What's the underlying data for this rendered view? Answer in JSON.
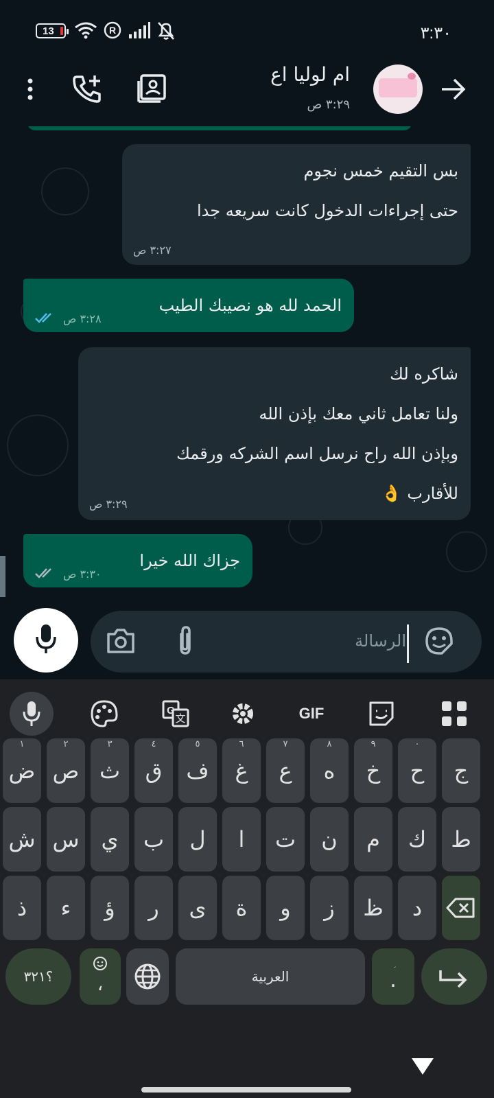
{
  "status_bar": {
    "battery_level": "13",
    "time": "٣:٣٠",
    "icons": [
      "battery-icon",
      "wifi-icon",
      "registered-icon",
      "signal-icon",
      "mute-icon"
    ],
    "colors": {
      "battery_low": "#e53935"
    }
  },
  "header": {
    "contact_name": "ام لوليا اع",
    "last_seen": "٣:٢٩ ص",
    "icons": [
      "back-arrow-icon",
      "avatar",
      "contact-card-icon",
      "add-call-icon",
      "more-options-icon"
    ]
  },
  "messages": [
    {
      "direction": "incoming",
      "lines": [
        "بس التقيم خمس نجوم",
        "حتى إجراءات الدخول كانت سريعه جدا"
      ],
      "time": "٣:٢٧ ص"
    },
    {
      "direction": "outgoing",
      "lines": [
        "الحمد لله هو نصيبك الطيب"
      ],
      "time": "٣:٢٨ ص",
      "status": "read"
    },
    {
      "direction": "incoming",
      "lines": [
        "شاكره لك",
        "ولنا تعامل ثاني معك بإذن الله",
        "وبإذن الله راح نرسل اسم الشركه ورقمك",
        "للأقارب 👌"
      ],
      "time": "٣:٢٩ ص"
    },
    {
      "direction": "outgoing",
      "lines": [
        "جزاك الله خيرا"
      ],
      "time": "٣:٣٠ ص",
      "status": "delivered"
    }
  ],
  "input": {
    "placeholder": "الرسالة",
    "value": "",
    "icons": [
      "sticker-icon",
      "attach-icon",
      "camera-icon",
      "mic-icon"
    ]
  },
  "keyboard": {
    "toolbar": [
      "mic-icon",
      "palette-icon",
      "translate-icon",
      "settings-icon",
      "gif-icon",
      "clipboard-icon",
      "apps-grid-icon"
    ],
    "gif_label": "GIF",
    "row1": [
      {
        "char": "ج",
        "hint": ""
      },
      {
        "char": "ح",
        "hint": "٠"
      },
      {
        "char": "خ",
        "hint": "٩"
      },
      {
        "char": "ه",
        "hint": "٨"
      },
      {
        "char": "ع",
        "hint": "٧"
      },
      {
        "char": "غ",
        "hint": "٦"
      },
      {
        "char": "ف",
        "hint": "٥"
      },
      {
        "char": "ق",
        "hint": "٤"
      },
      {
        "char": "ث",
        "hint": "٣"
      },
      {
        "char": "ص",
        "hint": "٢"
      },
      {
        "char": "ض",
        "hint": "١"
      }
    ],
    "row2": [
      "ط",
      "ك",
      "م",
      "ن",
      "ت",
      "ا",
      "ل",
      "ب",
      "ي",
      "س",
      "ش"
    ],
    "row3": [
      "د",
      "ظ",
      "ز",
      "و",
      "ة",
      "ى",
      "ر",
      "ؤ",
      "ء",
      "ذ"
    ],
    "bottom": {
      "symbols_label": "؟٣٢١",
      "comma": "،",
      "space_label": "العربية",
      "dot": ".",
      "dot_hint": "ؚ"
    },
    "colors": {
      "accent_key": "#344434"
    }
  },
  "colors": {
    "background": "#0b141a",
    "incoming_bubble": "#202c33",
    "outgoing_bubble": "#005c4b",
    "read_ticks": "#53bdeb"
  }
}
